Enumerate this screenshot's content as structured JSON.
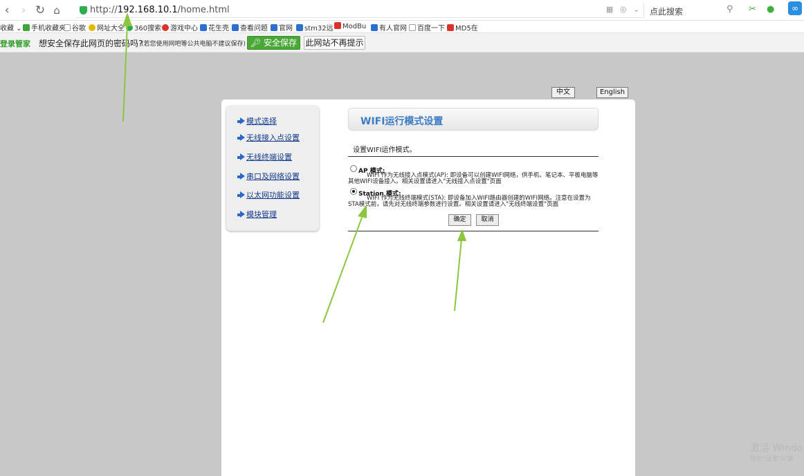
{
  "browser": {
    "url_prefix": "http://",
    "url_host": "192.168.10.1",
    "url_path": "/home.html",
    "url_tools": "▦ ◎ ⌄",
    "search_placeholder": "点此搜索",
    "back_icon": "chevron-left-icon",
    "forward_icon": "chevron-right-icon",
    "refresh_icon": "refresh-icon",
    "home_icon": "home-icon"
  },
  "bookmarks": [
    {
      "label": "收藏 ⌄",
      "color": "#ffffff"
    },
    {
      "label": "手机收藏夹",
      "color": "#3fa43a"
    },
    {
      "label": "谷歌",
      "color": "#dddddd"
    },
    {
      "label": "网址大全",
      "color": "#e6b800"
    },
    {
      "label": "360搜索",
      "color": "#2fa84f"
    },
    {
      "label": "游戏中心",
      "color": "#d9342b"
    },
    {
      "label": "花生壳",
      "color": "#2a6fd1"
    },
    {
      "label": "查看问题",
      "color": "#2a6fd1"
    },
    {
      "label": "官网",
      "color": "#2a6fd1"
    },
    {
      "label": "stm32远",
      "color": "#2a6fd1"
    },
    {
      "label": "ModBu",
      "color": "#d9342b"
    },
    {
      "label": "有人官网",
      "color": "#2a6fd1"
    },
    {
      "label": "百度一下",
      "color": "#dddddd"
    },
    {
      "label": "MD5在",
      "color": "#d9342b"
    }
  ],
  "password_bar": {
    "brand": "登录管家",
    "question": "想安全保存此网页的密码吗?",
    "note": "(若您使用网吧等公共电脑不建议保存)",
    "save_label": "安全保存",
    "no_more_label": "此网站不再提示"
  },
  "language": {
    "zh": "中文",
    "en": "English"
  },
  "sidebar": {
    "items": [
      {
        "label": "模式选择"
      },
      {
        "label": "无线接入点设置"
      },
      {
        "label": "无线终端设置"
      },
      {
        "label": "串口及网络设置"
      },
      {
        "label": "以太网功能设置"
      },
      {
        "label": "模块管理"
      }
    ]
  },
  "main": {
    "title": "WIFI运行模式设置",
    "description": "设置WIFI运作模式。",
    "modes": [
      {
        "label": "AP 模式:",
        "selected": false,
        "desc": "WIFI 作为无线接入点模式(AP): 即设备可以创建WIFI网络，供手机、笔记本、平板电脑等其他WIFI设备接入。相关设置请进入\"无线接入点设置\"页面"
      },
      {
        "label": "Station 模式:",
        "selected": true,
        "desc": "WIFI 作为无线终端模式(STA): 即设备加入WIFI路由器创建的WIFI网络。注意在设置为STA模式前，请先对无线终端参数进行设置。相关设置请进入\"无线终端设置\"页面"
      }
    ],
    "ok_label": "确定",
    "cancel_label": "取消"
  },
  "watermark": {
    "line1": "激活 Windo",
    "line2": "转到\"设置\"以激"
  },
  "colors": {
    "accent_green": "#4aa936",
    "title_blue": "#3b7cc4",
    "annotation_arrow": "#8cc63f"
  }
}
